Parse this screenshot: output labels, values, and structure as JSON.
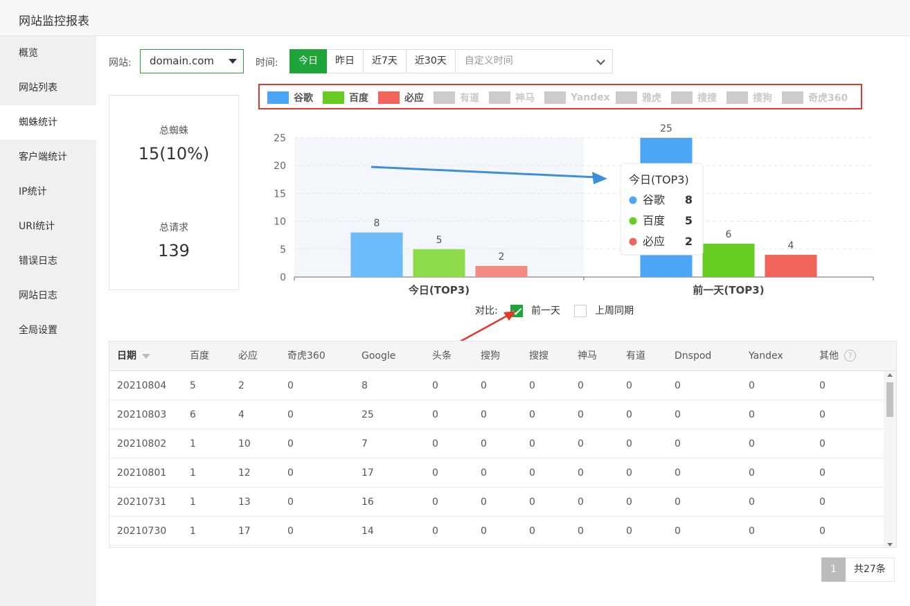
{
  "header": {
    "title": "网站监控报表"
  },
  "sidebar": {
    "items": [
      {
        "label": "概览",
        "active": false
      },
      {
        "label": "网站列表",
        "active": false
      },
      {
        "label": "蜘蛛统计",
        "active": true
      },
      {
        "label": "客户端统计",
        "active": false
      },
      {
        "label": "IP统计",
        "active": false
      },
      {
        "label": "URI统计",
        "active": false
      },
      {
        "label": "错误日志",
        "active": false
      },
      {
        "label": "网站日志",
        "active": false
      },
      {
        "label": "全局设置",
        "active": false
      }
    ]
  },
  "filters": {
    "site_label": "网站:",
    "site_value": "domain.com",
    "time_label": "时间:",
    "time_buttons": [
      "今日",
      "昨日",
      "近7天",
      "近30天"
    ],
    "time_active": "今日",
    "custom_time_placeholder": "自定义时间"
  },
  "stats": {
    "spider_label": "总蜘蛛",
    "spider_value": "15(10%)",
    "request_label": "总请求",
    "request_value": "139"
  },
  "legend": [
    {
      "name": "谷歌",
      "color": "#4da6f5",
      "enabled": true
    },
    {
      "name": "百度",
      "color": "#66cc22",
      "enabled": true
    },
    {
      "name": "必应",
      "color": "#f0645a",
      "enabled": true
    },
    {
      "name": "有道",
      "color": "#cccccc",
      "enabled": false
    },
    {
      "name": "神马",
      "color": "#cccccc",
      "enabled": false
    },
    {
      "name": "Yandex",
      "color": "#cccccc",
      "enabled": false
    },
    {
      "name": "雅虎",
      "color": "#cccccc",
      "enabled": false
    },
    {
      "name": "搜搜",
      "color": "#cccccc",
      "enabled": false
    },
    {
      "name": "搜狗",
      "color": "#cccccc",
      "enabled": false
    },
    {
      "name": "奇虎360",
      "color": "#cccccc",
      "enabled": false
    }
  ],
  "chart_data": {
    "type": "bar",
    "categories": [
      "今日(TOP3)",
      "前一天(TOP3)"
    ],
    "series": [
      {
        "name": "谷歌",
        "values": [
          8,
          25
        ],
        "color_today": "#6bbcf8",
        "color_prev": "#4da6f5"
      },
      {
        "name": "百度",
        "values": [
          5,
          6
        ],
        "color_today": "#8cdc4a",
        "color_prev": "#66cc22"
      },
      {
        "name": "必应",
        "values": [
          2,
          4
        ],
        "color_today": "#f38a82",
        "color_prev": "#f0645a"
      }
    ],
    "y_ticks": [
      0,
      5,
      10,
      15,
      20,
      25
    ],
    "ylim": [
      0,
      25
    ],
    "grid": true,
    "highlighted_category": "今日(TOP3)"
  },
  "tooltip": {
    "title": "今日(TOP3)",
    "items": [
      {
        "name": "谷歌",
        "value": "8",
        "color": "#4da6f5"
      },
      {
        "name": "百度",
        "value": "5",
        "color": "#66cc22"
      },
      {
        "name": "必应",
        "value": "2",
        "color": "#f0645a"
      }
    ]
  },
  "compare": {
    "label": "对比:",
    "options": [
      {
        "label": "前一天",
        "checked": true
      },
      {
        "label": "上周同期",
        "checked": false
      }
    ]
  },
  "table": {
    "headers": [
      "日期",
      "百度",
      "必应",
      "奇虎360",
      "Google",
      "头条",
      "搜狗",
      "搜搜",
      "神马",
      "有道",
      "Dnspod",
      "Yandex",
      "其他"
    ],
    "rows": [
      [
        "20210804",
        "5",
        "2",
        "0",
        "8",
        "0",
        "0",
        "0",
        "0",
        "0",
        "0",
        "0",
        "0"
      ],
      [
        "20210803",
        "6",
        "4",
        "0",
        "25",
        "0",
        "0",
        "0",
        "0",
        "0",
        "0",
        "0",
        "0"
      ],
      [
        "20210802",
        "1",
        "10",
        "0",
        "7",
        "0",
        "0",
        "0",
        "0",
        "0",
        "0",
        "0",
        "0"
      ],
      [
        "20210801",
        "1",
        "12",
        "0",
        "17",
        "0",
        "0",
        "0",
        "0",
        "0",
        "0",
        "0",
        "0"
      ],
      [
        "20210731",
        "1",
        "13",
        "0",
        "16",
        "0",
        "0",
        "0",
        "0",
        "0",
        "0",
        "0",
        "0"
      ],
      [
        "20210730",
        "1",
        "17",
        "0",
        "14",
        "0",
        "0",
        "0",
        "0",
        "0",
        "0",
        "0",
        "0"
      ]
    ]
  },
  "pagination": {
    "current": "1",
    "total": "共27条"
  },
  "colors": {
    "accent": "#20a53a",
    "annotation": "#e0392b",
    "arrow_blue": "#3d8fdc"
  }
}
